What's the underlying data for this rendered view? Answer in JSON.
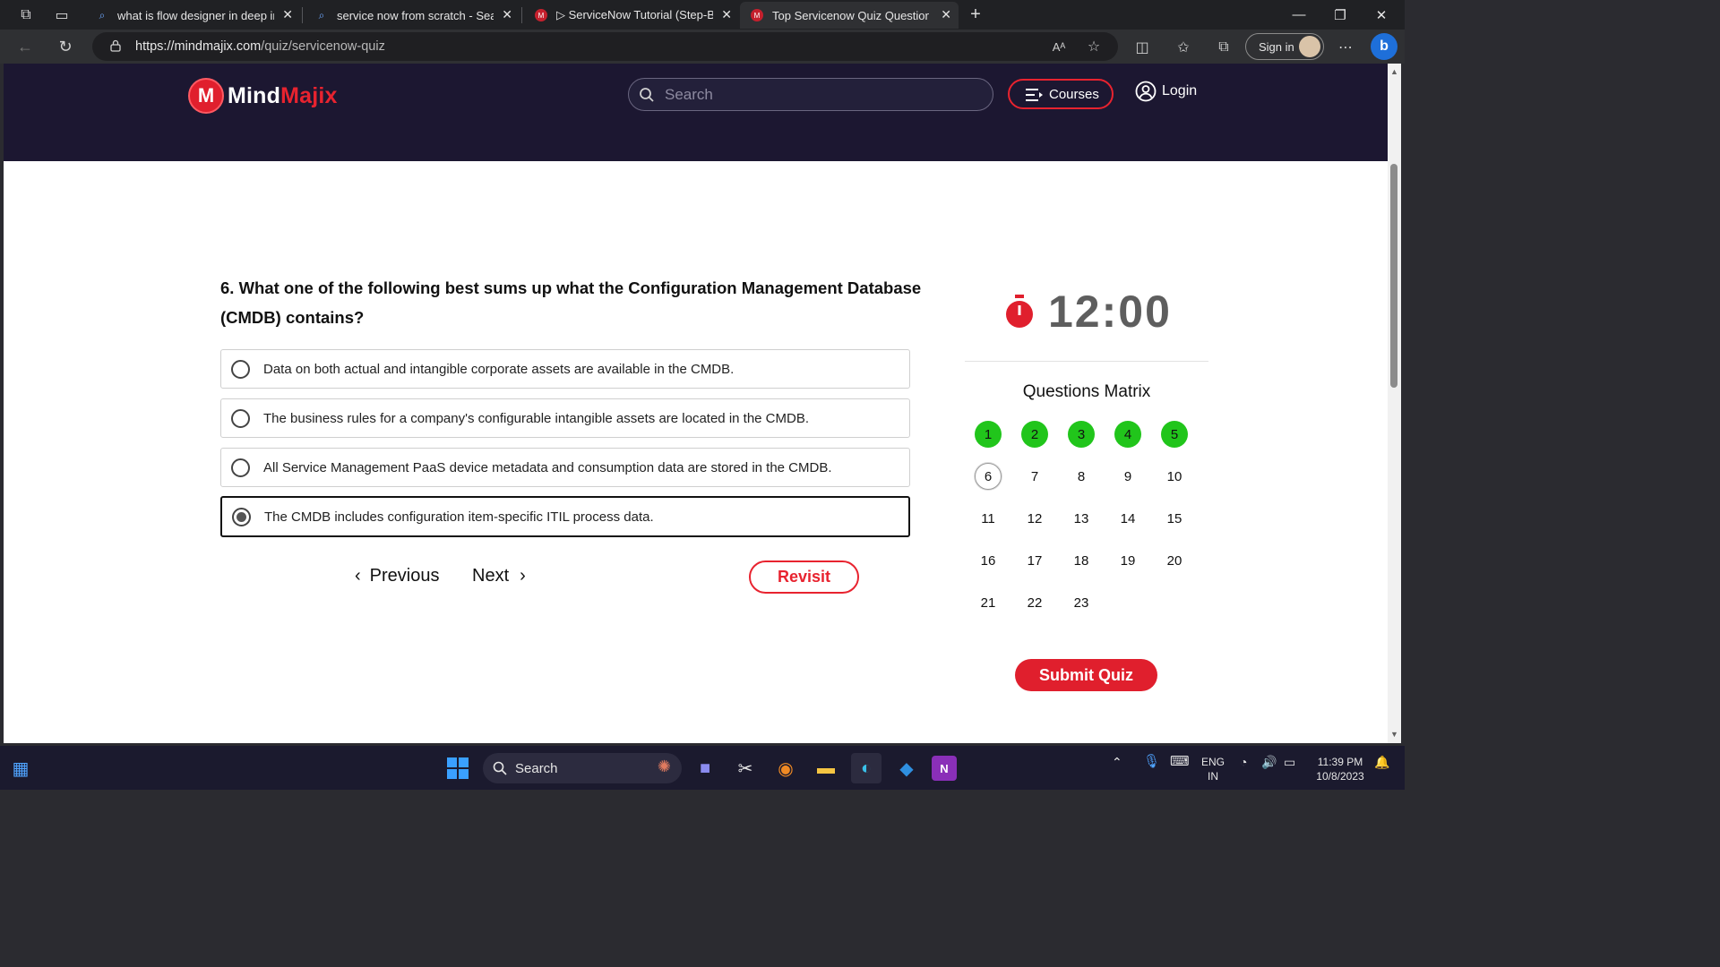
{
  "browser": {
    "tabs": [
      {
        "label": "what is flow designer in deep in s",
        "icon": "search-icon"
      },
      {
        "label": "service now from scratch - Search",
        "icon": "search-icon"
      },
      {
        "label": "▷ ServiceNow Tutorial (Step-By-S",
        "icon": "mindmajix-favicon"
      },
      {
        "label": "Top Servicenow Quiz Questions",
        "icon": "mindmajix-favicon"
      }
    ],
    "url_host": "https://mindmajix.com",
    "url_path": "/quiz/servicenow-quiz",
    "signin_label": "Sign in"
  },
  "site": {
    "logo_main": "Mind",
    "logo_accent": "Majix",
    "search_placeholder": "Search",
    "courses_label": "Courses",
    "login_label": "Login",
    "brand_color": "#e8232f"
  },
  "quiz": {
    "question": "6. What one of the following best sums up what the Configuration Management Database (CMDB) contains?",
    "options": [
      {
        "text": "Data on both actual and intangible corporate assets are available in the CMDB.",
        "selected": false
      },
      {
        "text": "The business rules for a company's configurable intangible assets are located in the CMDB.",
        "selected": false
      },
      {
        "text": "All Service Management PaaS device metadata and consumption data are stored in the CMDB.",
        "selected": false
      },
      {
        "text": "The CMDB includes configuration item-specific ITIL process data.",
        "selected": true
      }
    ],
    "previous_label": "Previous",
    "next_label": "Next",
    "revisit_label": "Revisit",
    "timer": "12:00",
    "matrix_title": "Questions Matrix",
    "matrix": [
      "1",
      "2",
      "3",
      "4",
      "5",
      "6",
      "7",
      "8",
      "9",
      "10",
      "11",
      "12",
      "13",
      "14",
      "15",
      "16",
      "17",
      "18",
      "19",
      "20",
      "21",
      "22",
      "23"
    ],
    "answered": [
      "1",
      "2",
      "3",
      "4",
      "5"
    ],
    "current": "6",
    "submit_label": "Submit Quiz"
  },
  "taskbar": {
    "search_label": "Search",
    "lang_line1": "ENG",
    "lang_line2": "IN",
    "time": "11:39 PM",
    "date": "10/8/2023"
  }
}
